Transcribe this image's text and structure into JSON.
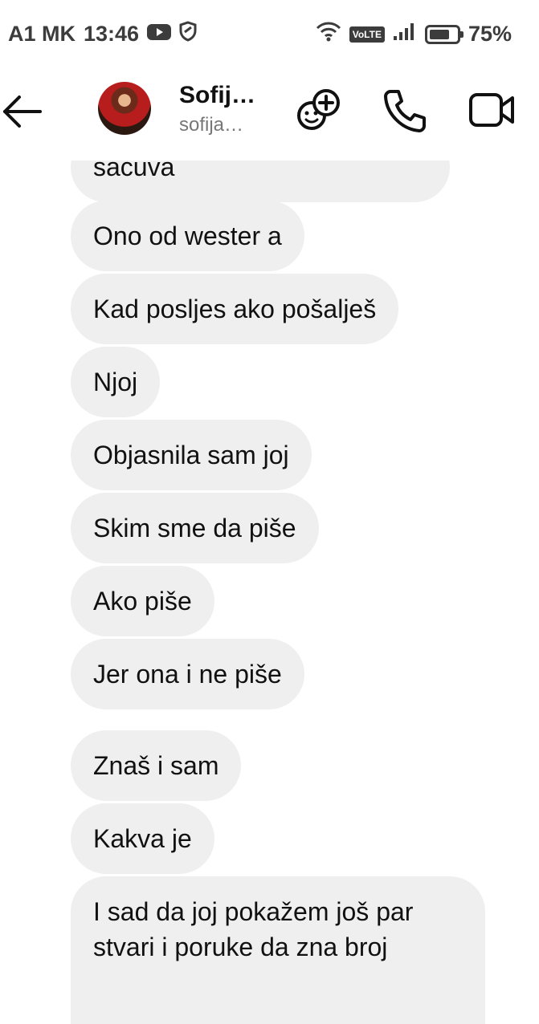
{
  "status_bar": {
    "carrier": "A1 MK",
    "time": "13:46",
    "battery_percent": "75%",
    "battery_level": 0.75,
    "network_badge": "VoLTE",
    "icons": [
      "youtube-icon",
      "shield-icon",
      "wifi-icon",
      "signal-icon",
      "battery-icon"
    ]
  },
  "header": {
    "name": "Sofij…",
    "handle": "sofija…",
    "icons": [
      "back-arrow-icon",
      "add-person-icon",
      "phone-icon",
      "video-icon"
    ]
  },
  "messages": [
    {
      "text": "sacuva"
    },
    {
      "text": "Ono od wester a"
    },
    {
      "text": "Kad posljes ako pošalješ"
    },
    {
      "text": "Njoj"
    },
    {
      "text": "Objasnila sam joj"
    },
    {
      "text": "Skim sme da piše"
    },
    {
      "text": "Ako piše"
    },
    {
      "text": "Jer ona i ne piše"
    },
    {
      "text": "Znaš i sam"
    },
    {
      "text": "Kakva je"
    },
    {
      "text": "I sad da joj pokažem još par stvari i poruke da zna broj"
    }
  ],
  "colors": {
    "bubble_bg": "#efefef",
    "text": "#111111",
    "secondary": "#777777"
  }
}
